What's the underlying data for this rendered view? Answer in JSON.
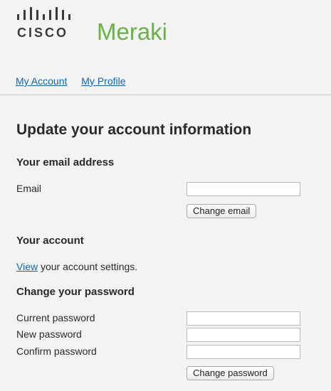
{
  "brand": {
    "cisco": "CISCO",
    "product": "Meraki",
    "colors": {
      "meraki_green": "#67b346",
      "cisco_gray": "#3b3b3b",
      "link_blue": "#0b66b8"
    }
  },
  "nav": {
    "items": [
      {
        "label": "My Account"
      },
      {
        "label": "My Profile"
      }
    ]
  },
  "page_title": "Update your account information",
  "email_section": {
    "heading": "Your email address",
    "email_label": "Email",
    "email_value": "",
    "change_button": "Change email"
  },
  "account_section": {
    "heading": "Your account",
    "view_link": "View",
    "view_text": " your account settings."
  },
  "password_section": {
    "heading": "Change your password",
    "current_label": "Current password",
    "new_label": "New password",
    "confirm_label": "Confirm password",
    "change_button": "Change password"
  }
}
